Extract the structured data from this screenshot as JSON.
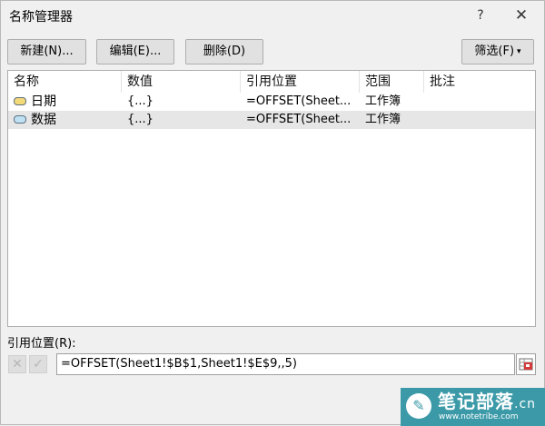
{
  "window": {
    "title": "名称管理器",
    "help_glyph": "?",
    "close_glyph": "✕"
  },
  "toolbar": {
    "new_label": "新建(N)...",
    "edit_label": "编辑(E)...",
    "delete_label": "删除(D)",
    "filter_label": "筛选(F)",
    "filter_caret": "▾"
  },
  "table": {
    "columns": [
      "名称",
      "数值",
      "引用位置",
      "范围",
      "批注"
    ],
    "rows": [
      {
        "tag_icon": "name-tag-icon",
        "tag_color": "#f3d977",
        "name": "日期",
        "value": "{...}",
        "refers_to": "=OFFSET(Sheet...",
        "scope": "工作簿",
        "comment": ""
      },
      {
        "tag_icon": "name-tag-icon",
        "tag_color": "#bfe1f4",
        "name": "数据",
        "value": "{...}",
        "refers_to": "=OFFSET(Sheet...",
        "scope": "工作簿",
        "comment": "",
        "selected": true
      }
    ]
  },
  "refers_to": {
    "label": "引用位置(R):",
    "value": "=OFFSET(Sheet1!$B$1,Sheet1!$E$9,,5)",
    "cancel_glyph": "✕",
    "confirm_glyph": "✓"
  },
  "watermark": {
    "brand": "笔记部落",
    "suffix": ".cn",
    "url": "www.notetribe.com",
    "icon_glyph": "✎"
  },
  "colors": {
    "selected_row": "#e6e6e6",
    "watermark_bg": "#3c9aa8"
  }
}
